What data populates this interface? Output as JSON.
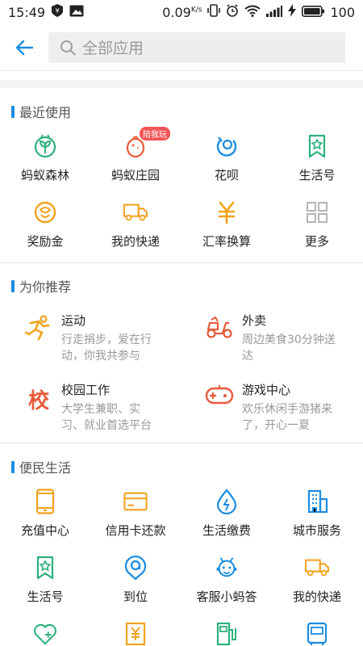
{
  "status_bar": {
    "time": "15:49",
    "net_speed": "0.09",
    "net_unit": "K/s",
    "battery": "100"
  },
  "header": {
    "search_placeholder": "全部应用"
  },
  "recent": {
    "title": "最近使用",
    "items": [
      {
        "label": "蚂蚁森林",
        "icon": "sprout-icon"
      },
      {
        "label": "蚂蚁庄园",
        "icon": "chick-icon",
        "badge": "陪我玩"
      },
      {
        "label": "花呗",
        "icon": "huabei-icon"
      },
      {
        "label": "生活号",
        "icon": "bookmark-star-icon"
      },
      {
        "label": "奖励金",
        "icon": "reward-icon"
      },
      {
        "label": "我的快递",
        "icon": "truck-icon"
      },
      {
        "label": "汇率换算",
        "icon": "yen-icon"
      },
      {
        "label": "更多",
        "icon": "grid-icon"
      }
    ]
  },
  "recommend": {
    "title": "为你推荐",
    "items": [
      {
        "title": "运动",
        "desc": "行走捐步，爱在行动，你我共参与",
        "icon": "runner-icon"
      },
      {
        "title": "外卖",
        "desc": "周边美食30分钟送达",
        "icon": "scooter-icon"
      },
      {
        "title": "校园工作",
        "desc": "大学生兼职、实习、就业首选平台",
        "icon": "campus-icon",
        "glyph": "校"
      },
      {
        "title": "游戏中心",
        "desc": "欢乐休闲手游猪来了，开心一夏",
        "icon": "gamepad-icon"
      }
    ]
  },
  "life": {
    "title": "便民生活",
    "items": [
      {
        "label": "充值中心",
        "icon": "phone-icon"
      },
      {
        "label": "信用卡还款",
        "icon": "credit-card-icon"
      },
      {
        "label": "生活缴费",
        "icon": "drop-icon"
      },
      {
        "label": "城市服务",
        "icon": "building-icon"
      },
      {
        "label": "生活号",
        "icon": "bookmark-star-icon"
      },
      {
        "label": "到位",
        "icon": "location-icon"
      },
      {
        "label": "客服小蚂答",
        "icon": "robot-icon"
      },
      {
        "label": "我的快递",
        "icon": "truck-icon"
      }
    ],
    "partial_icons": [
      "health-icon",
      "yen-doc-icon",
      "fuel-icon",
      "bus-icon"
    ]
  },
  "colors": {
    "accent": "#1a8ce0",
    "green": "#2bb17a",
    "orange": "#f3a21d",
    "red": "#e85a3a",
    "blue": "#1a8ce0"
  }
}
